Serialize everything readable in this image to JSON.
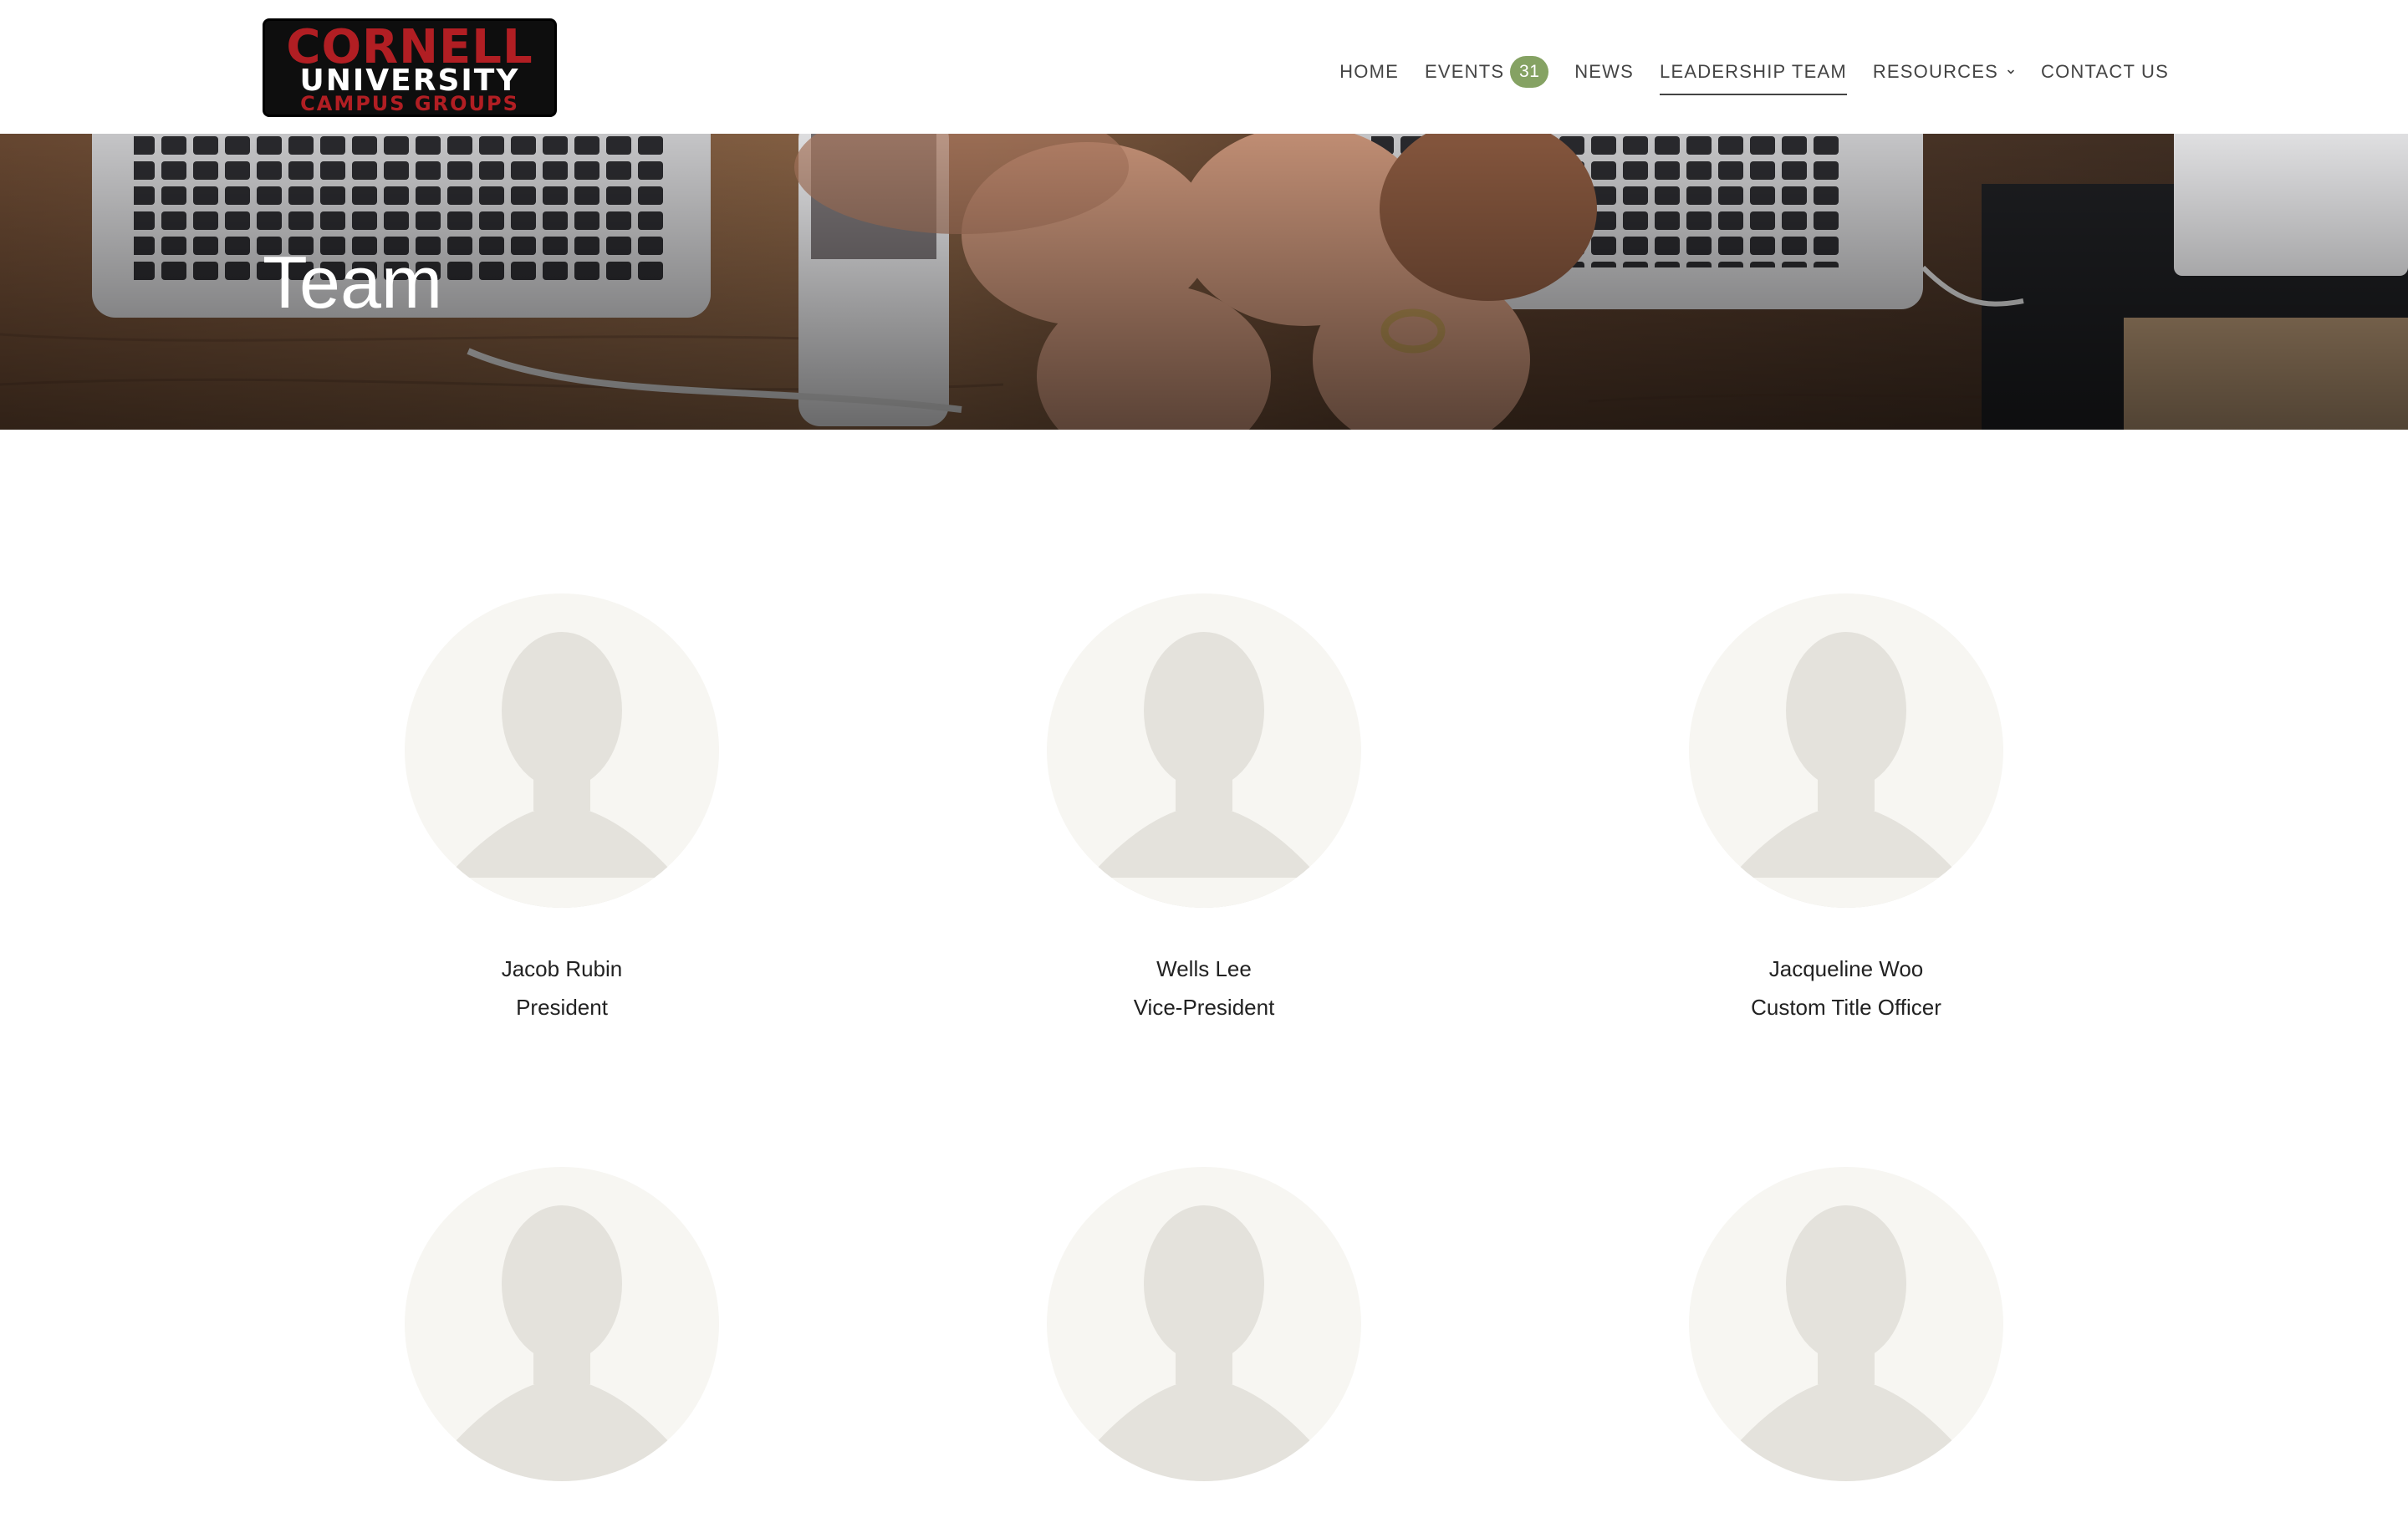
{
  "logo": {
    "line1": "CORNELL",
    "line2": "UNIVERSITY",
    "line3": "CAMPUS GROUPS"
  },
  "nav": {
    "items": [
      {
        "label": "HOME"
      },
      {
        "label": "EVENTS",
        "badge": "31"
      },
      {
        "label": "NEWS"
      },
      {
        "label": "LEADERSHIP TEAM",
        "active": true
      },
      {
        "label": "RESOURCES",
        "icon": "chevron-down-icon"
      },
      {
        "label": "CONTACT US"
      }
    ]
  },
  "hero": {
    "title": "Team"
  },
  "team": {
    "members": [
      {
        "name": "Jacob Rubin",
        "title": "President"
      },
      {
        "name": "Wells Lee",
        "title": "Vice-President"
      },
      {
        "name": "Jacqueline Woo",
        "title": "Custom Title Officer"
      },
      {
        "name": "",
        "title": ""
      },
      {
        "name": "",
        "title": ""
      },
      {
        "name": "",
        "title": ""
      }
    ]
  },
  "colors": {
    "badge": "#85a263",
    "logo_red": "#b11e23",
    "avatar_bg": "#f7f6f2",
    "avatar_silhouette": "#e4e2dc"
  }
}
